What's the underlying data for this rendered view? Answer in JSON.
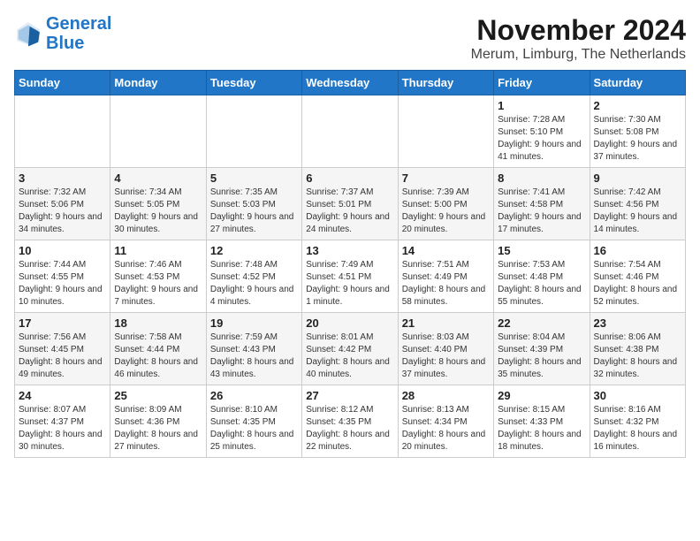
{
  "logo": {
    "line1": "General",
    "line2": "Blue"
  },
  "header": {
    "month": "November 2024",
    "location": "Merum, Limburg, The Netherlands"
  },
  "weekdays": [
    "Sunday",
    "Monday",
    "Tuesday",
    "Wednesday",
    "Thursday",
    "Friday",
    "Saturday"
  ],
  "weeks": [
    [
      {
        "day": "",
        "sunrise": "",
        "sunset": "",
        "daylight": ""
      },
      {
        "day": "",
        "sunrise": "",
        "sunset": "",
        "daylight": ""
      },
      {
        "day": "",
        "sunrise": "",
        "sunset": "",
        "daylight": ""
      },
      {
        "day": "",
        "sunrise": "",
        "sunset": "",
        "daylight": ""
      },
      {
        "day": "",
        "sunrise": "",
        "sunset": "",
        "daylight": ""
      },
      {
        "day": "1",
        "sunrise": "Sunrise: 7:28 AM",
        "sunset": "Sunset: 5:10 PM",
        "daylight": "Daylight: 9 hours and 41 minutes."
      },
      {
        "day": "2",
        "sunrise": "Sunrise: 7:30 AM",
        "sunset": "Sunset: 5:08 PM",
        "daylight": "Daylight: 9 hours and 37 minutes."
      }
    ],
    [
      {
        "day": "3",
        "sunrise": "Sunrise: 7:32 AM",
        "sunset": "Sunset: 5:06 PM",
        "daylight": "Daylight: 9 hours and 34 minutes."
      },
      {
        "day": "4",
        "sunrise": "Sunrise: 7:34 AM",
        "sunset": "Sunset: 5:05 PM",
        "daylight": "Daylight: 9 hours and 30 minutes."
      },
      {
        "day": "5",
        "sunrise": "Sunrise: 7:35 AM",
        "sunset": "Sunset: 5:03 PM",
        "daylight": "Daylight: 9 hours and 27 minutes."
      },
      {
        "day": "6",
        "sunrise": "Sunrise: 7:37 AM",
        "sunset": "Sunset: 5:01 PM",
        "daylight": "Daylight: 9 hours and 24 minutes."
      },
      {
        "day": "7",
        "sunrise": "Sunrise: 7:39 AM",
        "sunset": "Sunset: 5:00 PM",
        "daylight": "Daylight: 9 hours and 20 minutes."
      },
      {
        "day": "8",
        "sunrise": "Sunrise: 7:41 AM",
        "sunset": "Sunset: 4:58 PM",
        "daylight": "Daylight: 9 hours and 17 minutes."
      },
      {
        "day": "9",
        "sunrise": "Sunrise: 7:42 AM",
        "sunset": "Sunset: 4:56 PM",
        "daylight": "Daylight: 9 hours and 14 minutes."
      }
    ],
    [
      {
        "day": "10",
        "sunrise": "Sunrise: 7:44 AM",
        "sunset": "Sunset: 4:55 PM",
        "daylight": "Daylight: 9 hours and 10 minutes."
      },
      {
        "day": "11",
        "sunrise": "Sunrise: 7:46 AM",
        "sunset": "Sunset: 4:53 PM",
        "daylight": "Daylight: 9 hours and 7 minutes."
      },
      {
        "day": "12",
        "sunrise": "Sunrise: 7:48 AM",
        "sunset": "Sunset: 4:52 PM",
        "daylight": "Daylight: 9 hours and 4 minutes."
      },
      {
        "day": "13",
        "sunrise": "Sunrise: 7:49 AM",
        "sunset": "Sunset: 4:51 PM",
        "daylight": "Daylight: 9 hours and 1 minute."
      },
      {
        "day": "14",
        "sunrise": "Sunrise: 7:51 AM",
        "sunset": "Sunset: 4:49 PM",
        "daylight": "Daylight: 8 hours and 58 minutes."
      },
      {
        "day": "15",
        "sunrise": "Sunrise: 7:53 AM",
        "sunset": "Sunset: 4:48 PM",
        "daylight": "Daylight: 8 hours and 55 minutes."
      },
      {
        "day": "16",
        "sunrise": "Sunrise: 7:54 AM",
        "sunset": "Sunset: 4:46 PM",
        "daylight": "Daylight: 8 hours and 52 minutes."
      }
    ],
    [
      {
        "day": "17",
        "sunrise": "Sunrise: 7:56 AM",
        "sunset": "Sunset: 4:45 PM",
        "daylight": "Daylight: 8 hours and 49 minutes."
      },
      {
        "day": "18",
        "sunrise": "Sunrise: 7:58 AM",
        "sunset": "Sunset: 4:44 PM",
        "daylight": "Daylight: 8 hours and 46 minutes."
      },
      {
        "day": "19",
        "sunrise": "Sunrise: 7:59 AM",
        "sunset": "Sunset: 4:43 PM",
        "daylight": "Daylight: 8 hours and 43 minutes."
      },
      {
        "day": "20",
        "sunrise": "Sunrise: 8:01 AM",
        "sunset": "Sunset: 4:42 PM",
        "daylight": "Daylight: 8 hours and 40 minutes."
      },
      {
        "day": "21",
        "sunrise": "Sunrise: 8:03 AM",
        "sunset": "Sunset: 4:40 PM",
        "daylight": "Daylight: 8 hours and 37 minutes."
      },
      {
        "day": "22",
        "sunrise": "Sunrise: 8:04 AM",
        "sunset": "Sunset: 4:39 PM",
        "daylight": "Daylight: 8 hours and 35 minutes."
      },
      {
        "day": "23",
        "sunrise": "Sunrise: 8:06 AM",
        "sunset": "Sunset: 4:38 PM",
        "daylight": "Daylight: 8 hours and 32 minutes."
      }
    ],
    [
      {
        "day": "24",
        "sunrise": "Sunrise: 8:07 AM",
        "sunset": "Sunset: 4:37 PM",
        "daylight": "Daylight: 8 hours and 30 minutes."
      },
      {
        "day": "25",
        "sunrise": "Sunrise: 8:09 AM",
        "sunset": "Sunset: 4:36 PM",
        "daylight": "Daylight: 8 hours and 27 minutes."
      },
      {
        "day": "26",
        "sunrise": "Sunrise: 8:10 AM",
        "sunset": "Sunset: 4:35 PM",
        "daylight": "Daylight: 8 hours and 25 minutes."
      },
      {
        "day": "27",
        "sunrise": "Sunrise: 8:12 AM",
        "sunset": "Sunset: 4:35 PM",
        "daylight": "Daylight: 8 hours and 22 minutes."
      },
      {
        "day": "28",
        "sunrise": "Sunrise: 8:13 AM",
        "sunset": "Sunset: 4:34 PM",
        "daylight": "Daylight: 8 hours and 20 minutes."
      },
      {
        "day": "29",
        "sunrise": "Sunrise: 8:15 AM",
        "sunset": "Sunset: 4:33 PM",
        "daylight": "Daylight: 8 hours and 18 minutes."
      },
      {
        "day": "30",
        "sunrise": "Sunrise: 8:16 AM",
        "sunset": "Sunset: 4:32 PM",
        "daylight": "Daylight: 8 hours and 16 minutes."
      }
    ]
  ]
}
